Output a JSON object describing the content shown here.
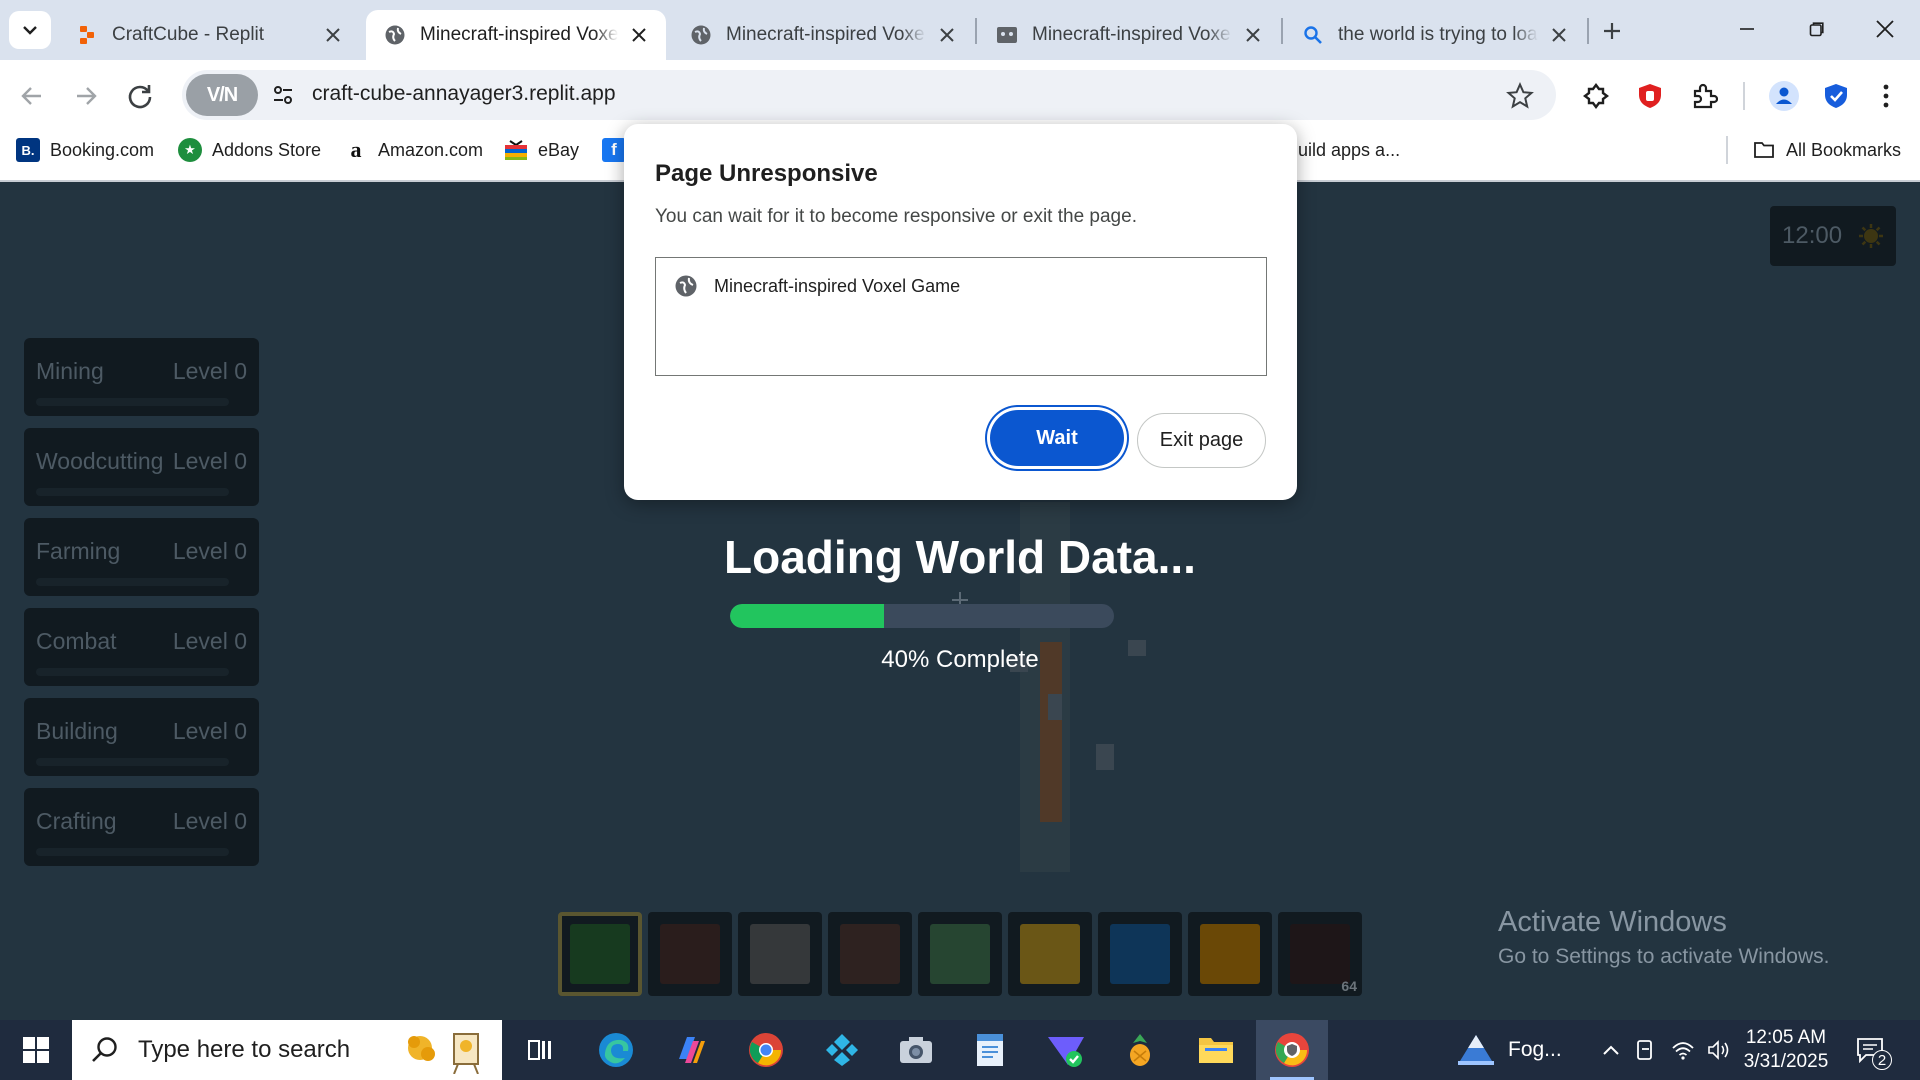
{
  "browser": {
    "tabs": [
      {
        "title": "CraftCube - Replit",
        "favicon": "replit-icon",
        "active": false
      },
      {
        "title": "Minecraft-inspired Voxel Game",
        "favicon": "globe-icon",
        "active": true
      },
      {
        "title": "Minecraft-inspired Voxel Game",
        "favicon": "globe-icon",
        "active": false
      },
      {
        "title": "Minecraft-inspired Voxel Game",
        "favicon": "sandbox-icon",
        "active": false
      },
      {
        "title": "the world is trying to load",
        "favicon": "search-icon",
        "active": false
      }
    ],
    "vpn_label": "V/N",
    "url": "craft-cube-annayager3.replit.app",
    "bookmarks": [
      {
        "label": "Booking.com",
        "icon": "booking-icon",
        "color": "#003580",
        "glyph": "B."
      },
      {
        "label": "Addons Store",
        "icon": "addons-store-icon",
        "color": "#1e8e3e",
        "glyph": "★"
      },
      {
        "label": "Amazon.com",
        "icon": "amazon-icon",
        "color": "#ffffff",
        "glyph": "a"
      },
      {
        "label": "eBay",
        "icon": "ebay-icon",
        "color": "#ffffff",
        "glyph": ""
      },
      {
        "label": "",
        "icon": "facebook-icon",
        "color": "#1877f2",
        "glyph": "f"
      }
    ],
    "bookmark_truncated": "uild apps a...",
    "all_bookmarks": "All Bookmarks"
  },
  "dialog": {
    "title": "Page Unresponsive",
    "message": "You can wait for it to become responsive or exit the page.",
    "page_name": "Minecraft-inspired Voxel Game",
    "wait_label": "Wait",
    "exit_label": "Exit page"
  },
  "game": {
    "skills": [
      {
        "name": "Mining",
        "level": "Level 0"
      },
      {
        "name": "Woodcutting",
        "level": "Level 0"
      },
      {
        "name": "Farming",
        "level": "Level 0"
      },
      {
        "name": "Combat",
        "level": "Level 0"
      },
      {
        "name": "Building",
        "level": "Level 0"
      },
      {
        "name": "Crafting",
        "level": "Level 0"
      }
    ],
    "time": "12:00",
    "loading_title": "Loading World Data...",
    "progress_fraction": 0.4,
    "progress_text": "40% Complete",
    "hotbar": [
      {
        "color": "#173a1f",
        "selected": true
      },
      {
        "color": "#2a1d1c"
      },
      {
        "color": "#35383a"
      },
      {
        "color": "#2e2220"
      },
      {
        "color": "#264531"
      },
      {
        "color": "#6a5616"
      },
      {
        "color": "#0e3558"
      },
      {
        "color": "#6a4806"
      },
      {
        "color": "#1e1618",
        "count": "64"
      }
    ]
  },
  "watermark": {
    "line1": "Activate Windows",
    "line2": "Go to Settings to activate Windows."
  },
  "taskbar": {
    "search_placeholder": "Type here to search",
    "weather": "Fog...",
    "time": "12:05 AM",
    "date": "3/31/2025",
    "notifications": "2"
  },
  "colors": {
    "accent": "#0b57d0",
    "progress": "#22c55e",
    "game_bg": "#233440"
  }
}
